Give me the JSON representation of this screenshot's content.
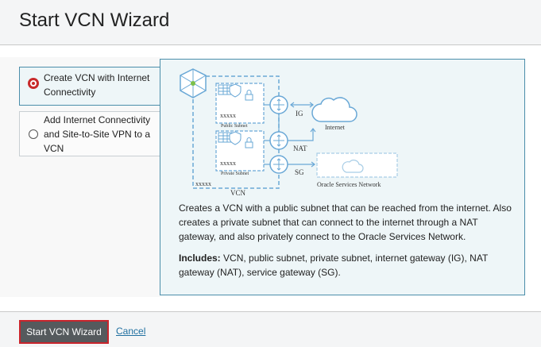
{
  "header": {
    "title": "Start VCN Wizard"
  },
  "options": [
    {
      "label_line1": "Create VCN with Internet",
      "label_line2": "Connectivity",
      "selected": true
    },
    {
      "label_line1": "Add Internet Connectivity",
      "label_line2": "and Site-to-Site VPN to a",
      "label_line3": "VCN",
      "selected": false
    }
  ],
  "diagram": {
    "public_subnet": "Public Subnet",
    "private_subnet": "Private Subnet",
    "cidr_public": "xxxxx",
    "cidr_private": "xxxxx",
    "cidr_vcn": "xxxxx",
    "vcn": "VCN",
    "ig": "IG",
    "nat": "NAT",
    "sg": "SG",
    "internet": "Internet",
    "oracle_services": "Oracle Services Network"
  },
  "detail": {
    "description": "Creates a VCN with a public subnet that can be reached from the internet. Also creates a private subnet that can connect to the internet through a NAT gateway, and also privately connect to the Oracle Services Network.",
    "includes_label": "Includes:",
    "includes_text": " VCN, public subnet, private subnet, internet gateway (IG), NAT gateway (NAT), service gateway (SG)."
  },
  "footer": {
    "start_label": "Start VCN Wizard",
    "cancel_label": "Cancel"
  },
  "colors": {
    "accent": "#4b8eaa",
    "diagram_blue": "#6aa8d6",
    "selected_red": "#c82b2b"
  }
}
